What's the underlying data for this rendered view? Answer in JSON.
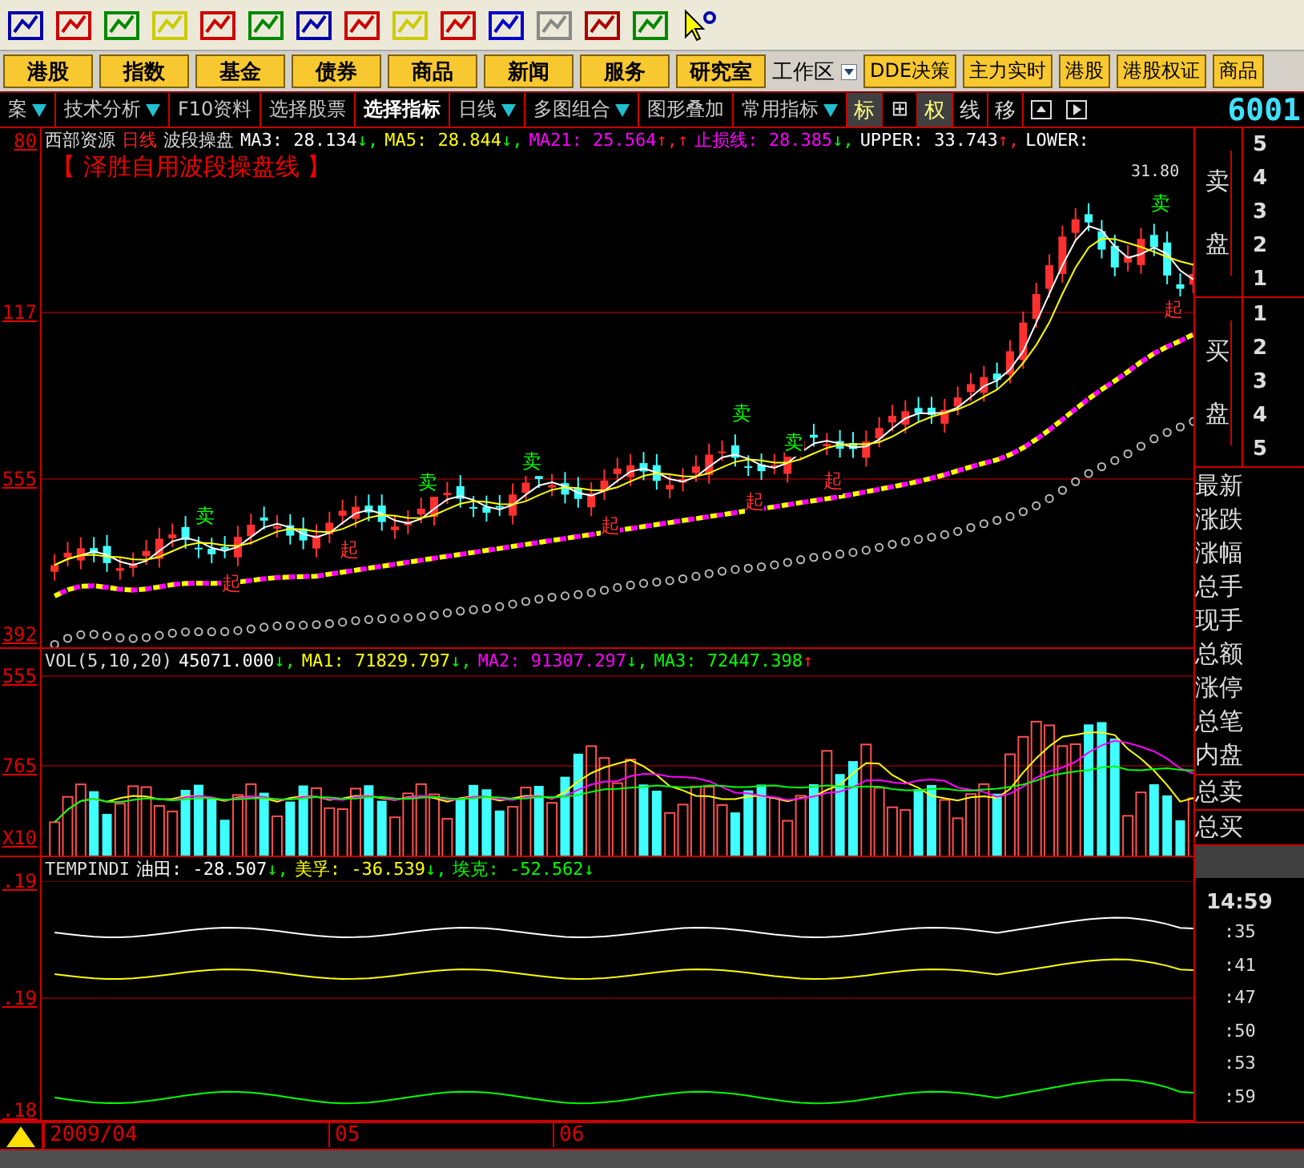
{
  "nav_buttons": [
    "港股",
    "指数",
    "基金",
    "债券",
    "商品",
    "新闻",
    "服务",
    "研究室"
  ],
  "workspace": {
    "label": "工作区"
  },
  "quick_buttons": [
    "DDE决策",
    "主力实时",
    "港股",
    "港股权证",
    "商品"
  ],
  "tabs": [
    {
      "label": "案",
      "selected": false,
      "dropdown": true
    },
    {
      "label": "技术分析",
      "selected": false,
      "dropdown": true
    },
    {
      "label": "F10资料",
      "selected": false,
      "dropdown": false
    },
    {
      "label": "选择股票",
      "selected": false,
      "dropdown": false
    },
    {
      "label": "选择指标",
      "selected": true,
      "dropdown": false
    },
    {
      "label": "日线",
      "selected": false,
      "dropdown": true
    },
    {
      "label": "多图组合",
      "selected": false,
      "dropdown": true
    },
    {
      "label": "图形叠加",
      "selected": false,
      "dropdown": false
    },
    {
      "label": "常用指标",
      "selected": false,
      "dropdown": true
    }
  ],
  "view_buttons": [
    {
      "label": "标",
      "selected": true
    },
    {
      "label": "⊞",
      "selected": false
    },
    {
      "label": "权",
      "selected": true
    },
    {
      "label": "线",
      "selected": false
    },
    {
      "label": "移",
      "selected": false
    }
  ],
  "stock_code": "6001",
  "price_panel": {
    "stock": "西部资源",
    "period": "日线",
    "formula": "波段操盘",
    "indicators": [
      {
        "text": "MA3: 28.134",
        "color": "#ffffff",
        "arrow": {
          "text": "↓,",
          "color": "#00ff00"
        }
      },
      {
        "text": "MA5: 28.844",
        "color": "#ffff00",
        "arrow": {
          "text": "↓,",
          "color": "#00ff00"
        }
      },
      {
        "text": "MA21: 25.564",
        "color": "#ff00ff",
        "arrow": {
          "text": "↑,",
          "color": "#ff2020"
        }
      },
      {
        "arrow": {
          "text": "↑",
          "color": "#ff2020"
        }
      },
      {
        "text": "止损线: 28.385",
        "color": "#ff00ff",
        "arrow": {
          "text": "↓,",
          "color": "#00ff00"
        }
      },
      {
        "text": "UPPER: 33.743",
        "color": "#ffffff",
        "arrow": {
          "text": "↑,",
          "color": "#ff2020"
        }
      },
      {
        "text": "LOWER:",
        "color": "#ffffff"
      }
    ],
    "subtitle": "【 泽胜自用波段操盘线 】",
    "peak_label": "31.80",
    "signals": [
      {
        "kind": "sell",
        "label": "卖"
      },
      {
        "kind": "sell",
        "label": "卖"
      },
      {
        "kind": "sell",
        "label": "卖"
      },
      {
        "kind": "sell",
        "label": "卖"
      },
      {
        "kind": "sell",
        "label": "卖"
      },
      {
        "kind": "sell",
        "label": "卖"
      },
      {
        "kind": "buy",
        "label": "起"
      },
      {
        "kind": "buy",
        "label": "起"
      },
      {
        "kind": "buy",
        "label": "起"
      },
      {
        "kind": "buy",
        "label": "起"
      },
      {
        "kind": "buy",
        "label": "起"
      },
      {
        "kind": "buy",
        "label": "起"
      }
    ],
    "axis": [
      "80",
      "117",
      "555",
      "392"
    ]
  },
  "volume_panel": {
    "name": "VOL(5,10,20)",
    "indicators": [
      {
        "text": "45071.000",
        "color": "#ffffff",
        "arrow": {
          "text": "↓,",
          "color": "#00ff00"
        }
      },
      {
        "text": "MA1: 71829.797",
        "color": "#ffff00",
        "arrow": {
          "text": "↓,",
          "color": "#00ff00"
        }
      },
      {
        "text": "MA2: 91307.297",
        "color": "#ff00ff",
        "arrow": {
          "text": "↓,",
          "color": "#00ff00"
        }
      },
      {
        "text": "MA3: 72447.398",
        "color": "#00ff00",
        "arrow": {
          "text": "↑",
          "color": "#ff2020"
        }
      }
    ],
    "axis": [
      "555",
      "765",
      "X10"
    ]
  },
  "indicator_panel": {
    "name": "TEMPINDI",
    "indicators": [
      {
        "text": "油田: -28.507",
        "color": "#ffffff",
        "arrow": {
          "text": "↓,",
          "color": "#00ff00"
        }
      },
      {
        "text": "美孚: -36.539",
        "color": "#ffff00",
        "arrow": {
          "text": "↓,",
          "color": "#00ff00"
        }
      },
      {
        "text": "埃克: -52.562",
        "color": "#00ff00",
        "arrow": {
          "text": "↓",
          "color": "#00ff00"
        }
      }
    ],
    "axis": [
      ".19",
      ".19",
      ".18"
    ]
  },
  "date_axis": [
    "2009/04",
    "05",
    "06"
  ],
  "quote_panel": {
    "ask_label": "卖盘",
    "ask_levels": [
      "5",
      "4",
      "3",
      "2",
      "1"
    ],
    "bid_label": "买盘",
    "bid_levels": [
      "1",
      "2",
      "3",
      "4",
      "5"
    ],
    "fields": [
      "最新",
      "涨跌",
      "涨幅",
      "总手",
      "现手",
      "总额",
      "涨停",
      "总笔",
      "内盘"
    ],
    "totals": [
      "总卖",
      "总买"
    ],
    "time": "14:59",
    "ticks": [
      ":35",
      ":41",
      ":47",
      ":50",
      ":53",
      ":59"
    ]
  }
}
